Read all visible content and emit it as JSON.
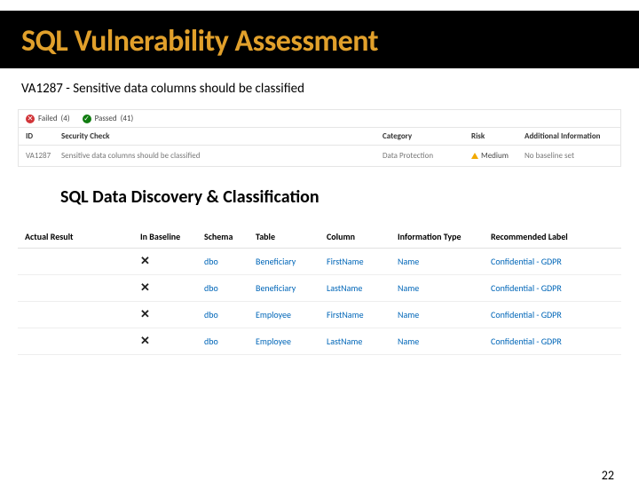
{
  "slide": {
    "title": "SQL Vulnerability Assessment",
    "subtitle": "VA1287 - Sensitive data columns should be classified",
    "page_number": "22"
  },
  "panel1": {
    "tabs": {
      "failed_label": "Failed",
      "failed_count": "(4)",
      "passed_label": "Passed",
      "passed_count": "(41)"
    },
    "headers": {
      "id": "ID",
      "security_check": "Security Check",
      "category": "Category",
      "risk": "Risk",
      "additional": "Additional Information"
    },
    "row": {
      "id": "VA1287",
      "security_check": "Sensitive data columns should be classified",
      "category": "Data Protection",
      "risk": "Medium",
      "additional": "No baseline set"
    }
  },
  "section2_title": "SQL Data Discovery & Classification",
  "table2": {
    "actual_result": "Actual Result",
    "headers": {
      "in_baseline": "In Baseline",
      "schema": "Schema",
      "table": "Table",
      "column": "Column",
      "info_type": "Information Type",
      "rec_label": "Recommended Label"
    },
    "rows": [
      {
        "ib": "✕",
        "schema": "dbo",
        "table": "Beneficiary",
        "column": "FirstName",
        "info": "Name",
        "rec": "Confidential - GDPR"
      },
      {
        "ib": "✕",
        "schema": "dbo",
        "table": "Beneficiary",
        "column": "LastName",
        "info": "Name",
        "rec": "Confidential - GDPR"
      },
      {
        "ib": "✕",
        "schema": "dbo",
        "table": "Employee",
        "column": "FirstName",
        "info": "Name",
        "rec": "Confidential - GDPR"
      },
      {
        "ib": "✕",
        "schema": "dbo",
        "table": "Employee",
        "column": "LastName",
        "info": "Name",
        "rec": "Confidential - GDPR"
      }
    ]
  }
}
